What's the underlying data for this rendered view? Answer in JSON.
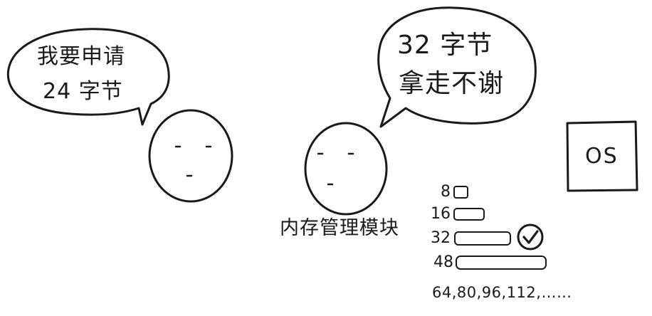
{
  "left_speaker": {
    "bubble_lines": [
      "我要申请",
      "24 字节"
    ]
  },
  "right_speaker": {
    "bubble_lines": [
      "32 字节",
      "拿走不谢"
    ],
    "label": "内存管理模块"
  },
  "os": {
    "label": "OS"
  },
  "size_classes": [
    {
      "size": "8",
      "selected": false
    },
    {
      "size": "16",
      "selected": false
    },
    {
      "size": "32",
      "selected": true
    },
    {
      "size": "48",
      "selected": false
    }
  ],
  "more_sizes": "64,80,96,112,……",
  "icons": {
    "selected_mark": "check-circle-icon"
  }
}
